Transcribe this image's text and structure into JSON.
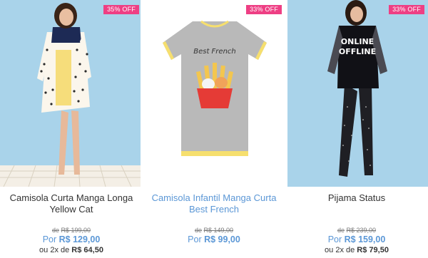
{
  "products": [
    {
      "badge": "35% OFF",
      "name_line1": "Camisola Curta Manga Longa",
      "name_line2": "Yellow Cat",
      "old_prefix": "de",
      "old_price": "R$ 199,00",
      "price_prefix": "Por",
      "price": "R$ 129,00",
      "inst_prefix": "ou 2x de",
      "inst_value": "R$ 64,50"
    },
    {
      "badge": "33% OFF",
      "name_line1": "Camisola Infantil Manga Curta",
      "name_line2": "Best French",
      "shirt_text": "Best French",
      "old_prefix": "de",
      "old_price": "R$ 149,00",
      "price_prefix": "Por",
      "price": "R$ 99,00",
      "inst_prefix": "",
      "inst_value": ""
    },
    {
      "badge": "33% OFF",
      "name_line1": "Pijama Status",
      "name_line2": "",
      "shirt_text_1": "ONLINE",
      "shirt_text_2": "OFFLINE",
      "old_prefix": "de",
      "old_price": "R$ 239,00",
      "price_prefix": "Por",
      "price": "R$ 159,00",
      "inst_prefix": "ou 2x de",
      "inst_value": "R$ 79,50"
    }
  ],
  "colors": {
    "badge": "#ee3f84",
    "price": "#5b97d6",
    "link_name": "#5b97d6"
  }
}
